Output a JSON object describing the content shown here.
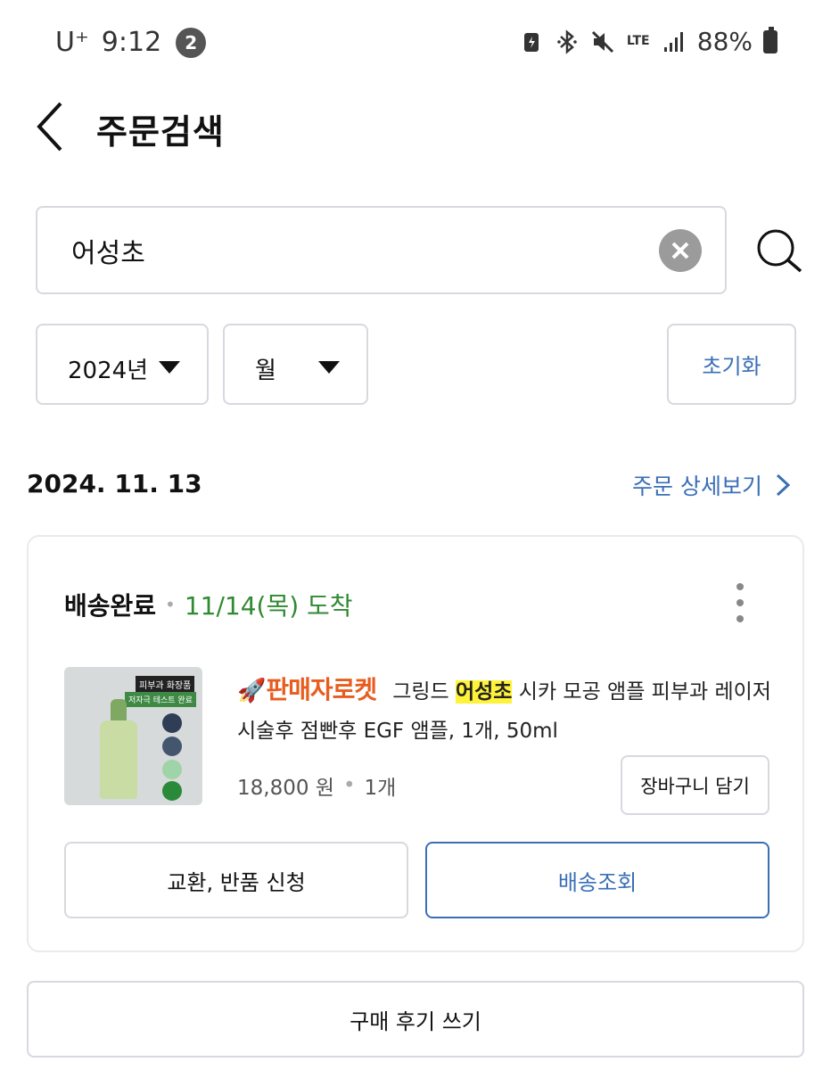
{
  "status_bar": {
    "carrier": "U⁺",
    "time": "9:12",
    "notification_count": "2",
    "network": "LTE",
    "battery": "88%"
  },
  "header": {
    "title": "주문검색"
  },
  "search": {
    "value": "어성초"
  },
  "filters": {
    "year": "2024년",
    "month": "월",
    "reset_label": "초기화"
  },
  "order": {
    "date": "2024. 11. 13",
    "detail_link": "주문 상세보기",
    "status": "배송완료",
    "arrival": "11/14(목) 도착",
    "seller_badge": "판매자로켓",
    "product_name_pre": "그링드",
    "product_name_highlight": "어성초",
    "product_name_post": "시카 모공 앰플 피부과 레이저 시술후 점빤후 EGF 앰플, 1개, 50ml",
    "price": "18,800 원",
    "quantity": "1개",
    "cart_button": "장바구니 담기",
    "exchange_button": "교환, 반품 신청",
    "tracking_button": "배송조회"
  },
  "review_button": "구매 후기 쓰기",
  "thumbnail": {
    "tag_top": "피부과 화장품",
    "tag_bottom": "저자극 테스트 완료"
  },
  "colors": {
    "accent_blue": "#3a6fb5",
    "arrival_green": "#2f8a31",
    "seller_orange": "#e85d1f",
    "highlight_yellow": "#fff23a"
  },
  "icons": [
    "back-icon",
    "clear-icon",
    "search-icon",
    "caret-down-icon",
    "chevron-right-icon",
    "more-vertical-icon",
    "rocket-icon",
    "bluetooth-icon",
    "mute-icon",
    "signal-icon",
    "battery-icon"
  ]
}
